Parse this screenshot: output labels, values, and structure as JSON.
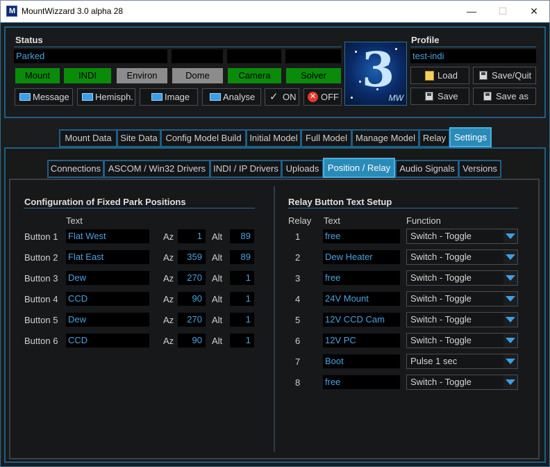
{
  "window": {
    "title": "MountWizzard 3.0 alpha 28",
    "min": "—",
    "max": "☐",
    "close": "✕"
  },
  "status": {
    "heading": "Status",
    "field1": "Parked",
    "indicators": [
      {
        "label": "Mount",
        "state": "green"
      },
      {
        "label": "INDI",
        "state": "green"
      },
      {
        "label": "Environ",
        "state": "grey"
      },
      {
        "label": "Dome",
        "state": "grey"
      },
      {
        "label": "Camera",
        "state": "green"
      },
      {
        "label": "Solver",
        "state": "green"
      }
    ],
    "buttons": {
      "message": "Message",
      "hemisph": "Hemisph.",
      "image": "Image",
      "analyse": "Analyse",
      "on": "ON",
      "off": "OFF"
    }
  },
  "logo": {
    "text": "3",
    "sub": "MW"
  },
  "profile": {
    "heading": "Profile",
    "name": "test-indi",
    "load": "Load",
    "save_quit": "Save/Quit",
    "save": "Save",
    "save_as": "Save as"
  },
  "main_tabs": [
    "Mount Data",
    "Site Data",
    "Config Model Build",
    "Initial Model",
    "Full Model",
    "Manage Model",
    "Relay",
    "Settings"
  ],
  "sub_tabs": [
    "Connections",
    "ASCOM / Win32 Drivers",
    "INDI / IP Drivers",
    "Uploads",
    "Position / Relay",
    "Audio Signals",
    "Versions"
  ],
  "park": {
    "heading": "Configuration of Fixed Park Positions",
    "col_text": "Text",
    "az_label": "Az",
    "alt_label": "Alt",
    "rows": [
      {
        "label": "Button 1",
        "text": "Flat West",
        "az": "1",
        "alt": "89"
      },
      {
        "label": "Button 2",
        "text": "Flat East",
        "az": "359",
        "alt": "89"
      },
      {
        "label": "Button 3",
        "text": "Dew",
        "az": "270",
        "alt": "1"
      },
      {
        "label": "Button 4",
        "text": "CCD",
        "az": "90",
        "alt": "1"
      },
      {
        "label": "Button 5",
        "text": "Dew",
        "az": "270",
        "alt": "1"
      },
      {
        "label": "Button 6",
        "text": "CCD",
        "az": "90",
        "alt": "1"
      }
    ]
  },
  "relay": {
    "heading": "Relay Button Text Setup",
    "col_relay": "Relay",
    "col_text": "Text",
    "col_function": "Function",
    "rows": [
      {
        "num": "1",
        "text": "free",
        "function": "Switch - Toggle"
      },
      {
        "num": "2",
        "text": "Dew Heater",
        "function": "Switch - Toggle"
      },
      {
        "num": "3",
        "text": "free",
        "function": "Switch - Toggle"
      },
      {
        "num": "4",
        "text": "24V Mount",
        "function": "Switch - Toggle"
      },
      {
        "num": "5",
        "text": "12V CCD Cam",
        "function": "Switch - Toggle"
      },
      {
        "num": "6",
        "text": "12V PC",
        "function": "Switch - Toggle"
      },
      {
        "num": "7",
        "text": "Boot",
        "function": "Pulse 1 sec"
      },
      {
        "num": "8",
        "text": "free",
        "function": "Switch - Toggle"
      }
    ]
  },
  "colors": {
    "accent": "#2a8ab8",
    "field_text": "#4aa3df",
    "ok_green": "#0a8c0a",
    "inactive_grey": "#8c8c8c"
  }
}
